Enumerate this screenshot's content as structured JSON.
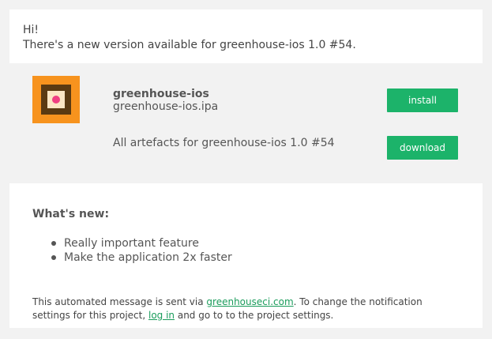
{
  "greeting": {
    "line1": "Hi!",
    "line2": "There's a new version available for greenhouse-ios 1.0 #54."
  },
  "release": {
    "app_icon": "greenhouse-app-icon",
    "app_name": "greenhouse-ios",
    "file_name": "greenhouse-ios.ipa",
    "install_label": "install",
    "artefacts_text": "All artefacts for greenhouse-ios 1.0 #54",
    "download_label": "download"
  },
  "whats_new": {
    "title": "What's new:",
    "items": [
      "Really important feature",
      "Make the application 2x faster"
    ]
  },
  "footer": {
    "part1": "This automated message is sent via ",
    "link_site": "greenhouseci.com",
    "part2": ". To change the notification settings for this project, ",
    "link_login": "log in",
    "part3": " and go to to the project settings."
  },
  "colors": {
    "background": "#f2f2f2",
    "card": "#ffffff",
    "button": "#1cb36a",
    "link": "#1a9c5b",
    "icon_orange": "#f7931e",
    "icon_brown": "#5a3a12",
    "icon_pink": "#ef3f82"
  }
}
